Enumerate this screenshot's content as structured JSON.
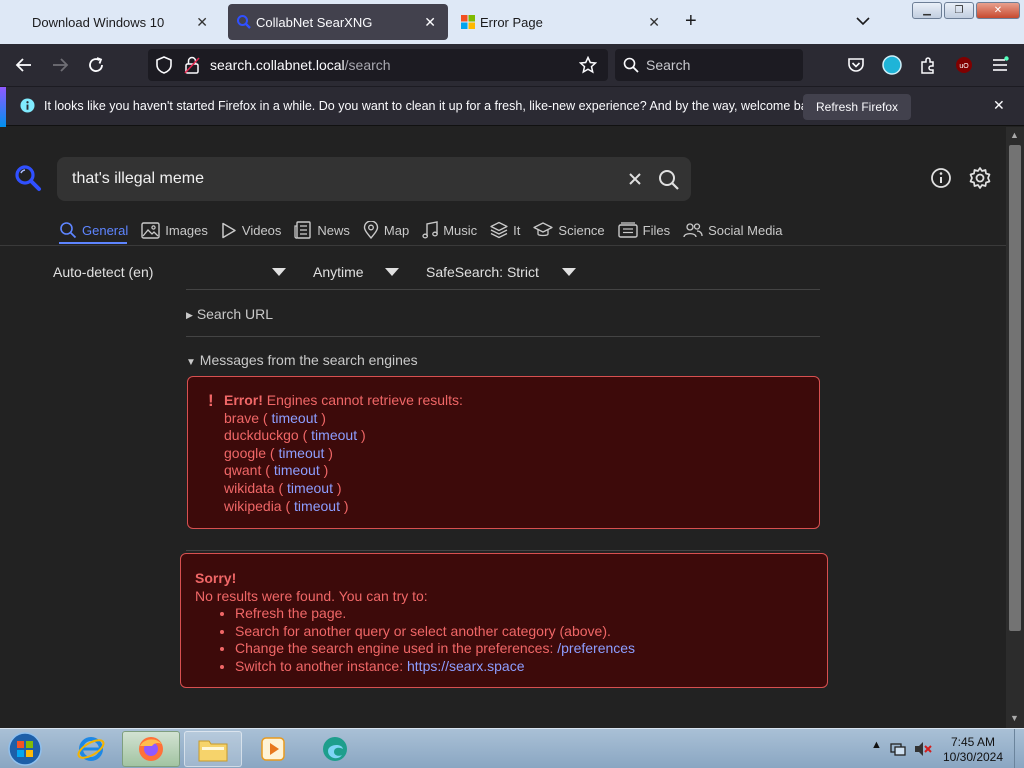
{
  "tabs": [
    {
      "title": "Download Windows 10",
      "active": false
    },
    {
      "title": "CollabNet SearXNG",
      "active": true
    },
    {
      "title": "Error Page",
      "active": false
    }
  ],
  "navbar": {
    "url_host": "search.collabnet.local",
    "url_path": "/search",
    "search_placeholder": "Search"
  },
  "notification": {
    "message": "It looks like you haven't started Firefox in a while. Do you want to clean it up for a fresh, like-new experience? And by the way, welcome back!",
    "button_label": "Refresh Firefox"
  },
  "search": {
    "query": "that's illegal meme"
  },
  "categories": [
    {
      "label": "General",
      "icon": "search-icon",
      "active": true
    },
    {
      "label": "Images",
      "icon": "image-icon",
      "active": false
    },
    {
      "label": "Videos",
      "icon": "play-icon",
      "active": false
    },
    {
      "label": "News",
      "icon": "newspaper-icon",
      "active": false
    },
    {
      "label": "Map",
      "icon": "map-pin-icon",
      "active": false
    },
    {
      "label": "Music",
      "icon": "music-note-icon",
      "active": false
    },
    {
      "label": "It",
      "icon": "layers-icon",
      "active": false
    },
    {
      "label": "Science",
      "icon": "graduation-cap-icon",
      "active": false
    },
    {
      "label": "Files",
      "icon": "files-icon",
      "active": false
    },
    {
      "label": "Social Media",
      "icon": "people-icon",
      "active": false
    }
  ],
  "filters": {
    "language": "Auto-detect (en)",
    "time_range": "Anytime",
    "safesearch": "SafeSearch: Strict"
  },
  "details": {
    "search_url_label": "Search URL",
    "messages_label": "Messages from the search engines"
  },
  "engine_error": {
    "title": "Error!",
    "message": "Engines cannot retrieve results:",
    "engines": [
      {
        "name": "brave",
        "reason": "timeout"
      },
      {
        "name": "duckduckgo",
        "reason": "timeout"
      },
      {
        "name": "google",
        "reason": "timeout"
      },
      {
        "name": "qwant",
        "reason": "timeout"
      },
      {
        "name": "wikidata",
        "reason": "timeout"
      },
      {
        "name": "wikipedia",
        "reason": "timeout"
      }
    ]
  },
  "no_results": {
    "title": "Sorry!",
    "message": "No results were found. You can try to:",
    "suggestions": [
      "Refresh the page.",
      "Search for another query or select another category (above).",
      "Change the search engine used in the preferences:",
      "Switch to another instance:"
    ],
    "preferences_link": "/preferences",
    "instance_link": "https://searx.space"
  },
  "taskbar": {
    "time": "7:45 AM",
    "date": "10/30/2024"
  },
  "colors": {
    "accent": "#5e85ff",
    "error_text": "#f06767",
    "error_bg": "#3d0a0a",
    "link": "#8d9eff"
  }
}
